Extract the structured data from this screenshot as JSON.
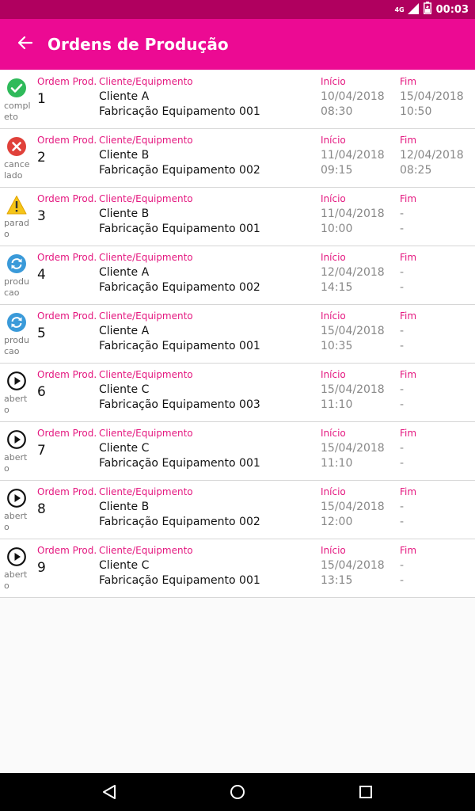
{
  "status_bar": {
    "time": "00:03",
    "network": "4G",
    "icons": [
      "signal-icon",
      "battery-icon"
    ]
  },
  "app_bar": {
    "title": "Ordens de Produção",
    "back_icon": "arrow-back-icon"
  },
  "labels": {
    "order": "Ordem Prod.",
    "client": "Cliente/Equipmento",
    "start": "Início",
    "end": "Fim"
  },
  "orders": [
    {
      "status": "completo",
      "icon": "check-circle-icon",
      "number": "1",
      "client": "Cliente A",
      "equipment": "Fabricação Equipamento 001",
      "start_date": "10/04/2018",
      "start_time": "08:30",
      "end_date": "15/04/2018",
      "end_time": "10:50"
    },
    {
      "status": "cancelado",
      "icon": "cancel-circle-icon",
      "number": "2",
      "client": "Cliente B",
      "equipment": "Fabricação Equipamento 002",
      "start_date": "11/04/2018",
      "start_time": "09:15",
      "end_date": "12/04/2018",
      "end_time": "08:25"
    },
    {
      "status": "parado",
      "icon": "warning-icon",
      "number": "3",
      "client": "Cliente B",
      "equipment": "Fabricação Equipamento 001",
      "start_date": "11/04/2018",
      "start_time": "10:00",
      "end_date": "-",
      "end_time": "-"
    },
    {
      "status": "producao",
      "icon": "sync-icon",
      "number": "4",
      "client": "Cliente A",
      "equipment": "Fabricação Equipamento 002",
      "start_date": "12/04/2018",
      "start_time": "14:15",
      "end_date": "-",
      "end_time": "-"
    },
    {
      "status": "producao",
      "icon": "sync-icon",
      "number": "5",
      "client": "Cliente A",
      "equipment": "Fabricação Equipamento 001",
      "start_date": "15/04/2018",
      "start_time": "10:35",
      "end_date": "-",
      "end_time": "-"
    },
    {
      "status": "aberto",
      "icon": "play-circle-icon",
      "number": "6",
      "client": "Cliente C",
      "equipment": "Fabricação Equipamento 003",
      "start_date": "15/04/2018",
      "start_time": "11:10",
      "end_date": "-",
      "end_time": "-"
    },
    {
      "status": "aberto",
      "icon": "play-circle-icon",
      "number": "7",
      "client": "Cliente C",
      "equipment": "Fabricação Equipamento 001",
      "start_date": "15/04/2018",
      "start_time": "11:10",
      "end_date": "-",
      "end_time": "-"
    },
    {
      "status": "aberto",
      "icon": "play-circle-icon",
      "number": "8",
      "client": "Cliente B",
      "equipment": "Fabricação Equipamento 002",
      "start_date": "15/04/2018",
      "start_time": "12:00",
      "end_date": "-",
      "end_time": "-"
    },
    {
      "status": "aberto",
      "icon": "play-circle-icon",
      "number": "9",
      "client": "Cliente C",
      "equipment": "Fabricação Equipamento 001",
      "start_date": "15/04/2018",
      "start_time": "13:15",
      "end_date": "-",
      "end_time": "-"
    }
  ],
  "nav_bar": {
    "icons": [
      "nav-back-icon",
      "nav-home-icon",
      "nav-recents-icon"
    ]
  },
  "colors": {
    "app_bar": "#ec0a93",
    "status_bar": "#b0005f",
    "label": "#e4177f",
    "completo": "#2fba5a",
    "cancelado": "#e0413a",
    "parado": "#f5c518",
    "producao": "#3a9ad9"
  }
}
